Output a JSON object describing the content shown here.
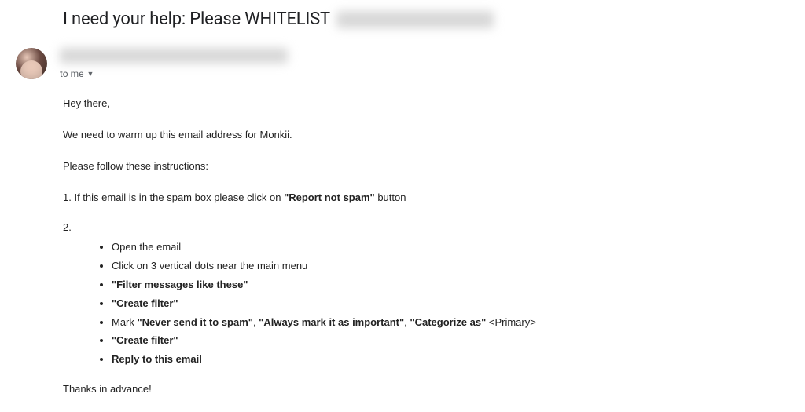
{
  "subject": {
    "text": "I need your help: Please WHITELIST"
  },
  "recipient": {
    "to": "to me"
  },
  "body": {
    "greeting": "Hey there,",
    "intro": "We need to warm up this email address for Monkii.",
    "instructions_lead": "Please follow these instructions:",
    "step1_prefix": "1. If this email is in the spam box please click on ",
    "step1_bold": "\"Report not spam\"",
    "step1_suffix": " button",
    "step2_num": "2.",
    "bullets": {
      "b1": "Open the email",
      "b2": "Click on 3 vertical dots near the main menu",
      "b3": "\"Filter messages like these\"",
      "b4": "\"Create filter\"",
      "b5_prefix": "Mark ",
      "b5_a": "\"Never send it to spam\"",
      "b5_sep1": ", ",
      "b5_b": "\"Always mark it as important\"",
      "b5_sep2": ", ",
      "b5_c": "\"Categorize as\"",
      "b5_suffix": " <Primary>",
      "b6": " \"Create filter\"",
      "b7": "Reply to this email"
    },
    "thanks": "Thanks in advance!"
  }
}
